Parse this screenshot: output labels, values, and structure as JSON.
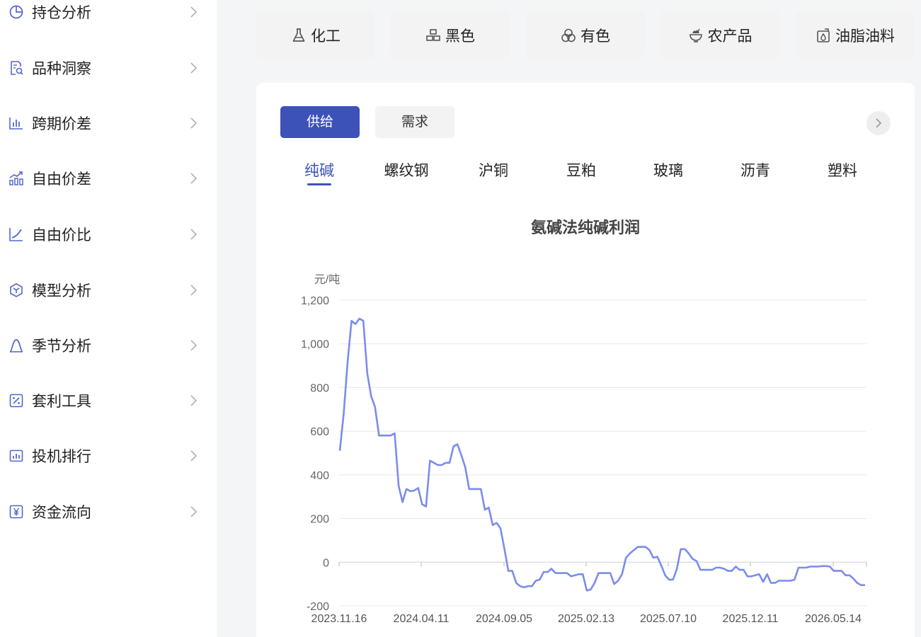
{
  "sidebar": {
    "items": [
      {
        "label": "持仓分析",
        "icon": "pie-chart-icon"
      },
      {
        "label": "品种洞察",
        "icon": "document-search-icon"
      },
      {
        "label": "跨期价差",
        "icon": "bar-chart-icon"
      },
      {
        "label": "自由价差",
        "icon": "trend-bars-icon"
      },
      {
        "label": "自由价比",
        "icon": "line-chart-icon"
      },
      {
        "label": "模型分析",
        "icon": "hexagon-model-icon"
      },
      {
        "label": "季节分析",
        "icon": "bell-curve-icon"
      },
      {
        "label": "套利工具",
        "icon": "percent-box-icon"
      },
      {
        "label": "投机排行",
        "icon": "ranking-chart-icon"
      },
      {
        "label": "资金流向",
        "icon": "yen-box-icon"
      }
    ]
  },
  "categories": [
    {
      "label": "化工",
      "icon": "flask-icon"
    },
    {
      "label": "黑色",
      "icon": "blocks-icon"
    },
    {
      "label": "有色",
      "icon": "circles-icon"
    },
    {
      "label": "农产品",
      "icon": "bowl-icon"
    },
    {
      "label": "油脂油料",
      "icon": "oil-can-icon"
    }
  ],
  "tabs": {
    "supply": "供给",
    "demand": "需求",
    "active": "supply"
  },
  "products": [
    "纯碱",
    "螺纹钢",
    "沪铜",
    "豆粕",
    "玻璃",
    "沥青",
    "塑料"
  ],
  "active_product": "纯碱",
  "colors": {
    "accent": "#3d52b8",
    "line": "#7b8cec",
    "grid": "#e6e8f0"
  },
  "chart_data": {
    "type": "line",
    "title": "氨碱法纯碱利润",
    "ylabel": "元/吨",
    "xlabel": "",
    "ylim": [
      -200,
      1200
    ],
    "yticks": [
      -200,
      0,
      200,
      400,
      600,
      800,
      1000,
      1200
    ],
    "ytick_labels": [
      "-200",
      "0",
      "200",
      "400",
      "600",
      "800",
      "1,000",
      "1,200"
    ],
    "xtick_labels": [
      "2023.11.16",
      "2024.04.11",
      "2024.09.05",
      "2025.02.13",
      "2025.07.10",
      "2025.12.11",
      "2026.05.14"
    ],
    "grid": true,
    "series": [
      {
        "name": "",
        "values": [
          510,
          680,
          920,
          1105,
          1090,
          1115,
          1105,
          865,
          760,
          710,
          580,
          580,
          580,
          580,
          590,
          350,
          275,
          335,
          325,
          328,
          340,
          265,
          255,
          465,
          455,
          445,
          445,
          455,
          455,
          530,
          540,
          490,
          435,
          335,
          335,
          335,
          335,
          240,
          250,
          170,
          180,
          155,
          60,
          -40,
          -40,
          -95,
          -110,
          -115,
          -110,
          -110,
          -85,
          -80,
          -45,
          -45,
          -30,
          -50,
          -50,
          -50,
          -50,
          -65,
          -60,
          -55,
          -55,
          -130,
          -125,
          -95,
          -50,
          -50,
          -50,
          -50,
          -100,
          -85,
          -55,
          20,
          40,
          55,
          70,
          70,
          70,
          55,
          20,
          25,
          -15,
          -60,
          -80,
          -80,
          -30,
          60,
          60,
          40,
          15,
          5,
          -35,
          -35,
          -35,
          -35,
          -25,
          -25,
          -30,
          -40,
          -40,
          -20,
          -35,
          -35,
          -65,
          -65,
          -60,
          -55,
          -90,
          -55,
          -95,
          -95,
          -85,
          -85,
          -85,
          -85,
          -80,
          -25,
          -25,
          -25,
          -20,
          -20,
          -20,
          -18,
          -18,
          -20,
          -40,
          -40,
          -40,
          -60,
          -60,
          -75,
          -95,
          -105,
          -105
        ]
      }
    ]
  }
}
